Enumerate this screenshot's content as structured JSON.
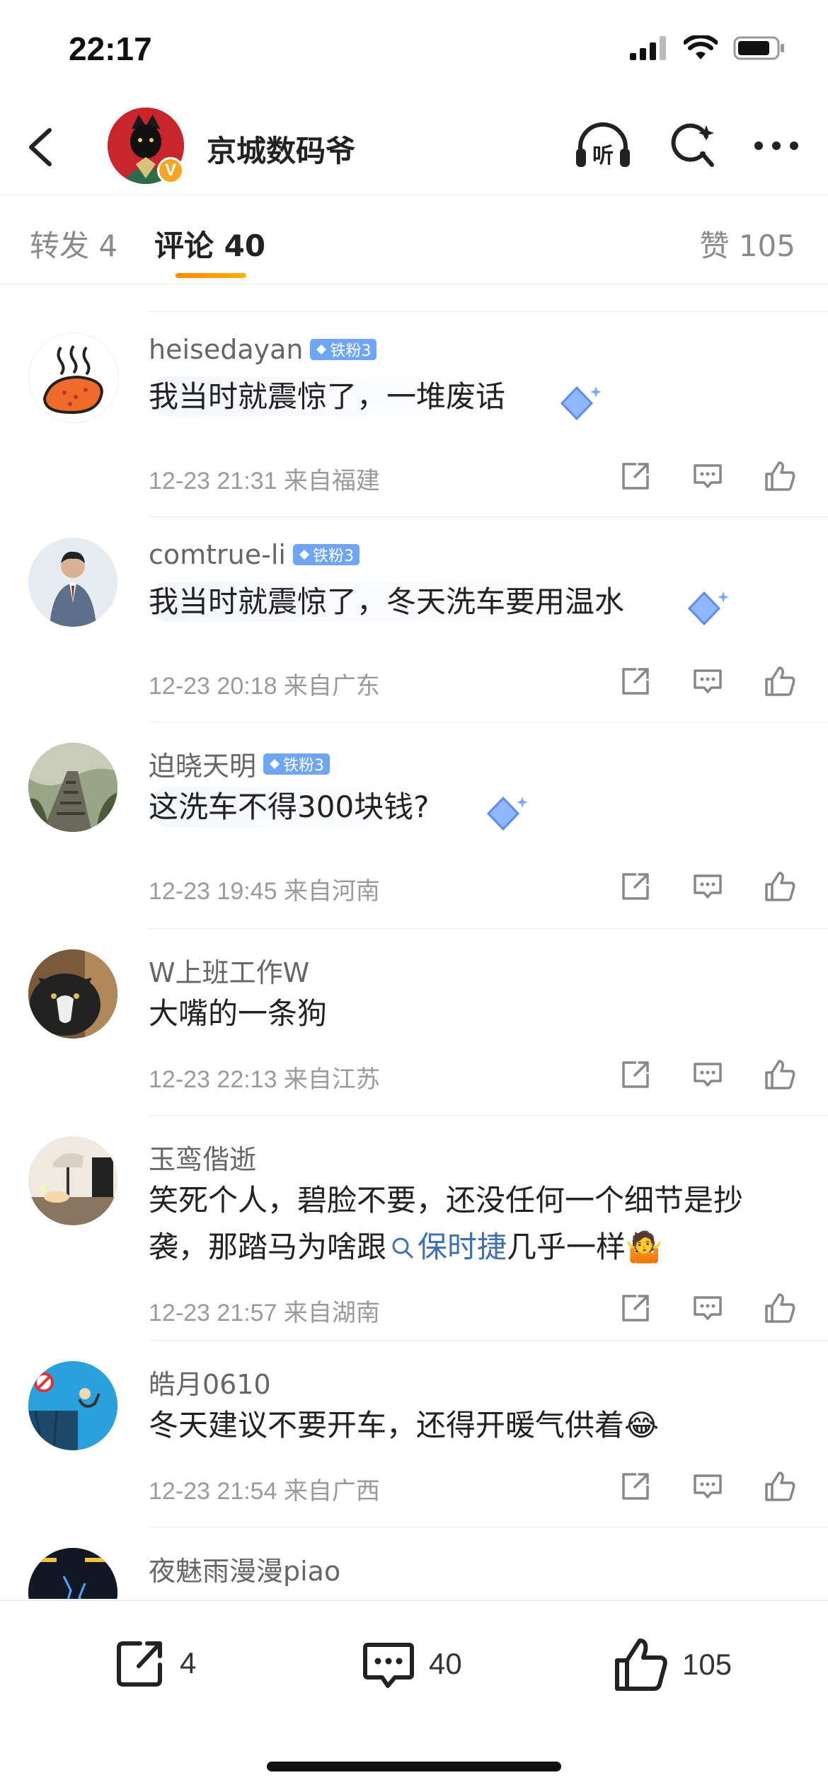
{
  "status_bar": {
    "time": "22:17"
  },
  "header": {
    "account_name": "京城数码爷",
    "verify_mark": "V",
    "listen_label": "听"
  },
  "tabs": [
    {
      "label": "转发 4"
    },
    {
      "label": "评论 40"
    },
    {
      "label": "赞 105"
    }
  ],
  "comments": [
    {
      "user": "heisedayan",
      "badge": "铁粉3",
      "text": "我当时就震惊了，一堆废话",
      "meta": "12-23 21:31 来自福建"
    },
    {
      "user": "comtrue-li",
      "badge": "铁粉3",
      "text": "我当时就震惊了，冬天洗车要用温水",
      "meta": "12-23 20:18 来自广东"
    },
    {
      "user": "迫晓天明",
      "badge": "铁粉3",
      "text": "这洗车不得300块钱?",
      "meta": "12-23 19:45 来自河南"
    },
    {
      "user": "W上班工作W",
      "text": "大嘴的一条狗",
      "meta": "12-23 22:13 来自江苏"
    },
    {
      "user": "玉鸾偕逝",
      "text_a": "笑死个人，碧脸不要，还没任何一个细节是抄袭，那踏马为啥跟",
      "link": "保时捷",
      "text_b": "几乎一样",
      "emoji": "🤷",
      "meta": "12-23 21:57 来自湖南"
    },
    {
      "user": "皓月0610",
      "text": "冬天建议不要开车，还得开暖气供着",
      "emoji": "😂",
      "meta": "12-23 21:54 来自广西"
    },
    {
      "user": "夜魅雨漫漫piao"
    }
  ],
  "bottom_bar": {
    "repost_count": "4",
    "comment_count": "40",
    "like_count": "105"
  }
}
